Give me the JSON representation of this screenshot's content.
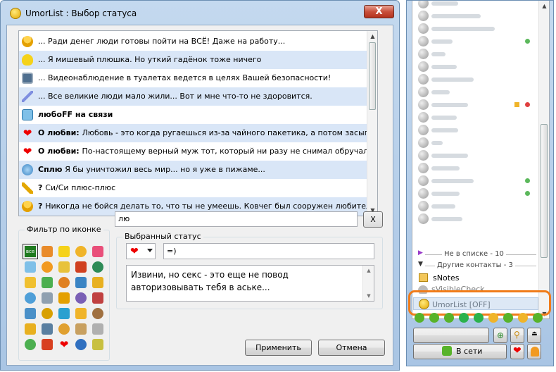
{
  "window": {
    "title": "UmorList : Выбор статуса",
    "close_glyph": "X"
  },
  "status_list": {
    "rows": [
      {
        "icon": "worker-icon",
        "prefix": "",
        "text": "... Ради денег люди готовы пойти на ВСЁ! Даже на работу...",
        "alt": false
      },
      {
        "icon": "duck-icon",
        "prefix": "",
        "text": "... Я мишевый плюшка. Но уткий гадёнок тоже ничего",
        "alt": true
      },
      {
        "icon": "camera-icon",
        "prefix": "",
        "text": "... Видеонаблюдение в туалетах ведется в целях Вашей безопасности!",
        "alt": false
      },
      {
        "icon": "syringe-icon",
        "prefix": "",
        "text": "... Все великие люди мало жили... Вот и мне что-то не здоровится.",
        "alt": true
      },
      {
        "icon": "phone-icon",
        "prefix": "любоFF на связи",
        "text": "",
        "alt": false
      },
      {
        "icon": "heart-icon",
        "prefix": "О любви:",
        "text": "Любовь - это когда ругаешься из-за чайного пакетика, а потом засыпаеш",
        "alt": true
      },
      {
        "icon": "heart-icon",
        "prefix": "О любви:",
        "text": "По-настоящему верный муж тот, который ни разу не снимал обручально",
        "alt": false
      },
      {
        "icon": "sleep-icon",
        "prefix": "Сплю",
        "text": "Я бы уничтожил весь мир... но я уже в пижаме...",
        "alt": true
      },
      {
        "icon": "wrench-icon",
        "prefix": "?",
        "text": "Си/Си плюс-плюс",
        "alt": false
      },
      {
        "icon": "worker-icon",
        "prefix": "?",
        "text": "Никогда не бойся делать то, что ты не умеешь. Ковчег был сооружен любителем. П",
        "alt": true
      }
    ]
  },
  "filter": {
    "label": "Фильтр по иконке",
    "all_label": "все"
  },
  "search": {
    "value": "лю",
    "clear_label": "X"
  },
  "selected": {
    "label": "Выбранный статус",
    "icon_glyph": "❤",
    "smile": "=)",
    "message_line1": "Извини, но секс - это еще не повод",
    "message_line2": "авторизовывать тебя в аське..."
  },
  "buttons": {
    "apply": "Применить",
    "cancel": "Отмена"
  },
  "contact_list": {
    "not_in_list": "Не в списке - 10",
    "other_contacts": "Другие контакты - 3",
    "snotes": "sNotes",
    "invisible": "sVisibleCheck",
    "umorlist": "UmorList [OFF]",
    "online_button": "В сети"
  }
}
